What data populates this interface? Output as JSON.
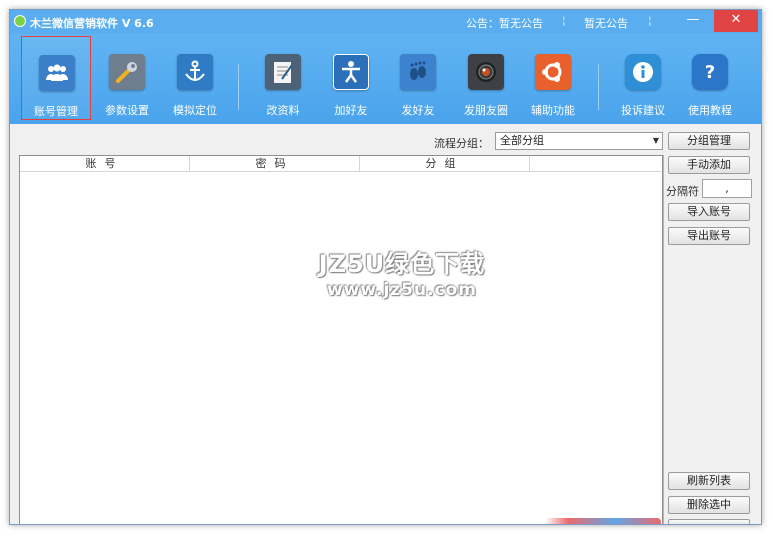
{
  "window": {
    "title": "木兰微信营销软件  V 6.6",
    "notice_1": "公告：暂无公告",
    "notice_2": "暂无公告",
    "minimize": "—",
    "close": "✕"
  },
  "toolbar": {
    "items": [
      {
        "label": "账号管理",
        "icon": "users-icon",
        "color": "#3a7fc8",
        "glyph": "👥",
        "selected": true
      },
      {
        "label": "参数设置",
        "icon": "wrench-icon",
        "color": "#6f7e8f",
        "glyph": "🔧"
      },
      {
        "label": "模拟定位",
        "icon": "anchor-icon",
        "color": "#2f7bc4",
        "glyph": "⚓"
      },
      {
        "label": "改资料",
        "icon": "notepad-icon",
        "color": "#4d6276",
        "glyph": "✎"
      },
      {
        "label": "加好友",
        "icon": "person-icon",
        "color": "#2a6fb8",
        "glyph": "♙"
      },
      {
        "label": "发好友",
        "icon": "footprint-icon",
        "color": "#3d82cf",
        "glyph": "◉"
      },
      {
        "label": "发朋友圈",
        "icon": "camera-icon",
        "color": "#3f4045",
        "glyph": "◎"
      },
      {
        "label": "辅助功能",
        "icon": "ubuntu-icon",
        "color": "#e8612c",
        "glyph": "✺"
      },
      {
        "label": "投诉建议",
        "icon": "info-icon",
        "color": "#2f8fd6",
        "glyph": "i"
      },
      {
        "label": "使用教程",
        "icon": "help-icon",
        "color": "#2b76c9",
        "glyph": "?"
      }
    ]
  },
  "filter": {
    "label": "流程分组：",
    "selected": "全部分组"
  },
  "table": {
    "columns": [
      "账号",
      "密码",
      "分组"
    ]
  },
  "watermark": {
    "line1": "JZ5U绿色下载",
    "line2": "www.jz5u.com"
  },
  "side": {
    "group_manage": "分组管理",
    "manual_add": "手动添加",
    "separator_label": "分隔符",
    "separator_value": ",",
    "import": "导入账号",
    "export": "导出账号",
    "refresh": "刷新列表",
    "delete_selected": "删除选中"
  }
}
